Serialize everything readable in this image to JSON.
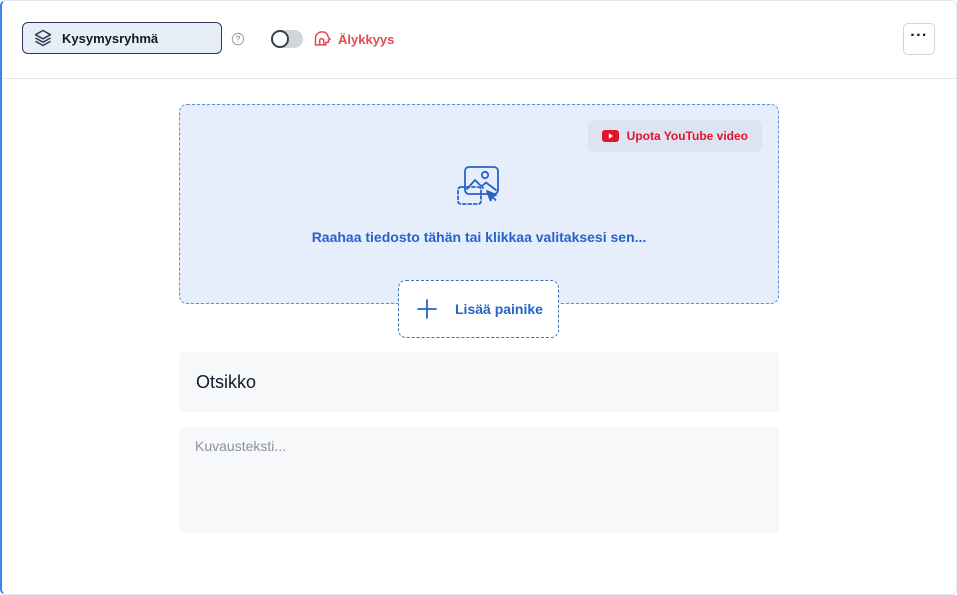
{
  "toolbar": {
    "question_type": {
      "label": "Kysymysryhmä",
      "icon": "layers-icon"
    },
    "help_icon": "help-circle-icon",
    "intelligence_toggle": {
      "on": false
    },
    "intelligence": {
      "label": "Älykkyys",
      "icon": "brain-icon",
      "color": "#e5484d"
    },
    "more_icon": "more-horizontal-icon"
  },
  "media": {
    "youtube_button": {
      "label": "Upota YouTube video",
      "icon": "youtube-icon",
      "color": "#e0142a"
    },
    "drop_icon": "image-upload-icon",
    "drop_text": "Raahaa tiedosto tähän tai klikkaa valitaksesi sen...",
    "accent_color": "#2563c9"
  },
  "add_button": {
    "label": "Lisää painike",
    "icon": "plus-icon"
  },
  "fields": {
    "title_placeholder": "Otsikko",
    "title_value": "",
    "description_placeholder": "Kuvausteksti...",
    "description_value": ""
  }
}
